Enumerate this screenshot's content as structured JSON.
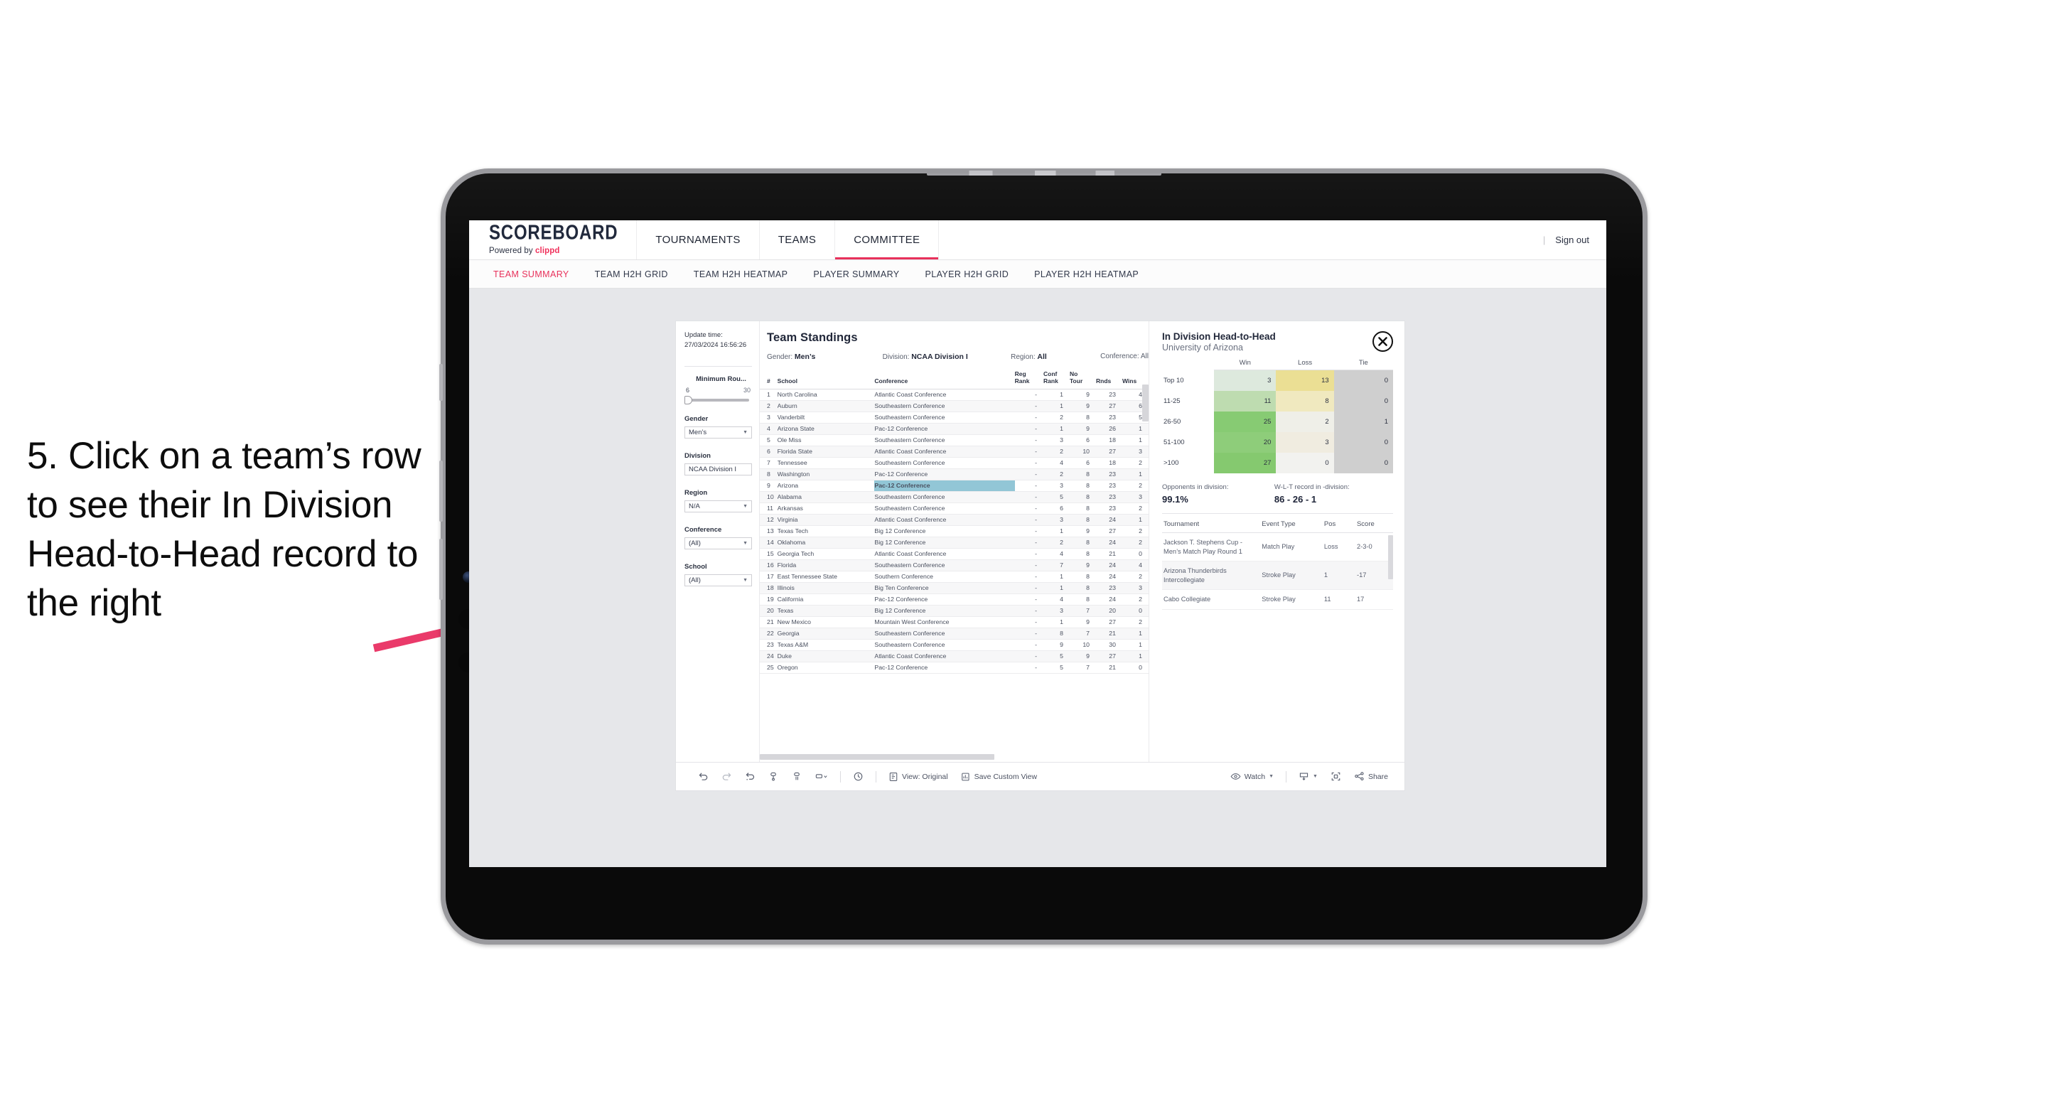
{
  "annotation": {
    "text": "5. Click on a team’s row to see their In Division Head-to-Head record to the right",
    "arrow_color": "#ea3a6a"
  },
  "header": {
    "brand_title": "SCOREBOARD",
    "brand_sub_prefix": "Powered by ",
    "brand_sub_name": "clippd",
    "nav": [
      {
        "label": "TOURNAMENTS",
        "active": false
      },
      {
        "label": "TEAMS",
        "active": false
      },
      {
        "label": "COMMITTEE",
        "active": true
      }
    ],
    "divider": "|",
    "sign_out": "Sign out",
    "accent_color": "#e8315b"
  },
  "subtabs": [
    {
      "label": "TEAM SUMMARY",
      "active": true
    },
    {
      "label": "TEAM H2H GRID",
      "active": false
    },
    {
      "label": "TEAM H2H HEATMAP",
      "active": false
    },
    {
      "label": "PLAYER SUMMARY",
      "active": false
    },
    {
      "label": "PLAYER H2H GRID",
      "active": false
    },
    {
      "label": "PLAYER H2H HEATMAP",
      "active": false
    }
  ],
  "filters": {
    "update_time_label": "Update time:",
    "update_time_value": "27/03/2024 16:56:26",
    "min_rounds": {
      "title": "Minimum Rou...",
      "min": "6",
      "max": "30"
    },
    "gender": {
      "title": "Gender",
      "value": "Men’s"
    },
    "division": {
      "title": "Division",
      "value": "NCAA Division I"
    },
    "region": {
      "title": "Region",
      "value": "N/A"
    },
    "conference": {
      "title": "Conference",
      "value": "(All)"
    },
    "school": {
      "title": "School",
      "value": "(All)"
    }
  },
  "standings": {
    "title": "Team Standings",
    "meta": {
      "gender_label": "Gender:",
      "gender_value": "Men’s",
      "division_label": "Division:",
      "division_value": "NCAA Division I",
      "region_label": "Region:",
      "region_value": "All",
      "conference_label": "Conference:",
      "conference_value": "All"
    },
    "columns": [
      "#",
      "School",
      "Conference",
      "Reg Rank",
      "Conf Rank",
      "No Tour",
      "Rnds",
      "Wins"
    ],
    "columns_split": [
      {
        "l1": "#",
        "l2": ""
      },
      {
        "l1": "School",
        "l2": ""
      },
      {
        "l1": "Conference",
        "l2": ""
      },
      {
        "l1": "Reg",
        "l2": "Rank"
      },
      {
        "l1": "Conf",
        "l2": "Rank"
      },
      {
        "l1": "No",
        "l2": "Tour"
      },
      {
        "l1": "",
        "l2": "Rnds"
      },
      {
        "l1": "",
        "l2": "Wins"
      }
    ],
    "highlighted_row_index": 8,
    "highlight_color": "#92c6d6",
    "rows": [
      {
        "rank": "1",
        "school": "North Carolina",
        "conference": "Atlantic Coast Conference",
        "reg_rank": "-",
        "conf_rank": "1",
        "no_tour": "9",
        "rnds": "23",
        "wins": "4"
      },
      {
        "rank": "2",
        "school": "Auburn",
        "conference": "Southeastern Conference",
        "reg_rank": "-",
        "conf_rank": "1",
        "no_tour": "9",
        "rnds": "27",
        "wins": "6"
      },
      {
        "rank": "3",
        "school": "Vanderbilt",
        "conference": "Southeastern Conference",
        "reg_rank": "-",
        "conf_rank": "2",
        "no_tour": "8",
        "rnds": "23",
        "wins": "5"
      },
      {
        "rank": "4",
        "school": "Arizona State",
        "conference": "Pac-12 Conference",
        "reg_rank": "-",
        "conf_rank": "1",
        "no_tour": "9",
        "rnds": "26",
        "wins": "1"
      },
      {
        "rank": "5",
        "school": "Ole Miss",
        "conference": "Southeastern Conference",
        "reg_rank": "-",
        "conf_rank": "3",
        "no_tour": "6",
        "rnds": "18",
        "wins": "1"
      },
      {
        "rank": "6",
        "school": "Florida State",
        "conference": "Atlantic Coast Conference",
        "reg_rank": "-",
        "conf_rank": "2",
        "no_tour": "10",
        "rnds": "27",
        "wins": "3"
      },
      {
        "rank": "7",
        "school": "Tennessee",
        "conference": "Southeastern Conference",
        "reg_rank": "-",
        "conf_rank": "4",
        "no_tour": "6",
        "rnds": "18",
        "wins": "2"
      },
      {
        "rank": "8",
        "school": "Washington",
        "conference": "Pac-12 Conference",
        "reg_rank": "-",
        "conf_rank": "2",
        "no_tour": "8",
        "rnds": "23",
        "wins": "1"
      },
      {
        "rank": "9",
        "school": "Arizona",
        "conference": "Pac-12 Conference",
        "reg_rank": "-",
        "conf_rank": "3",
        "no_tour": "8",
        "rnds": "23",
        "wins": "2"
      },
      {
        "rank": "10",
        "school": "Alabama",
        "conference": "Southeastern Conference",
        "reg_rank": "-",
        "conf_rank": "5",
        "no_tour": "8",
        "rnds": "23",
        "wins": "3"
      },
      {
        "rank": "11",
        "school": "Arkansas",
        "conference": "Southeastern Conference",
        "reg_rank": "-",
        "conf_rank": "6",
        "no_tour": "8",
        "rnds": "23",
        "wins": "2"
      },
      {
        "rank": "12",
        "school": "Virginia",
        "conference": "Atlantic Coast Conference",
        "reg_rank": "-",
        "conf_rank": "3",
        "no_tour": "8",
        "rnds": "24",
        "wins": "1"
      },
      {
        "rank": "13",
        "school": "Texas Tech",
        "conference": "Big 12 Conference",
        "reg_rank": "-",
        "conf_rank": "1",
        "no_tour": "9",
        "rnds": "27",
        "wins": "2"
      },
      {
        "rank": "14",
        "school": "Oklahoma",
        "conference": "Big 12 Conference",
        "reg_rank": "-",
        "conf_rank": "2",
        "no_tour": "8",
        "rnds": "24",
        "wins": "2"
      },
      {
        "rank": "15",
        "school": "Georgia Tech",
        "conference": "Atlantic Coast Conference",
        "reg_rank": "-",
        "conf_rank": "4",
        "no_tour": "8",
        "rnds": "21",
        "wins": "0"
      },
      {
        "rank": "16",
        "school": "Florida",
        "conference": "Southeastern Conference",
        "reg_rank": "-",
        "conf_rank": "7",
        "no_tour": "9",
        "rnds": "24",
        "wins": "4"
      },
      {
        "rank": "17",
        "school": "East Tennessee State",
        "conference": "Southern Conference",
        "reg_rank": "-",
        "conf_rank": "1",
        "no_tour": "8",
        "rnds": "24",
        "wins": "2"
      },
      {
        "rank": "18",
        "school": "Illinois",
        "conference": "Big Ten Conference",
        "reg_rank": "-",
        "conf_rank": "1",
        "no_tour": "8",
        "rnds": "23",
        "wins": "3"
      },
      {
        "rank": "19",
        "school": "California",
        "conference": "Pac-12 Conference",
        "reg_rank": "-",
        "conf_rank": "4",
        "no_tour": "8",
        "rnds": "24",
        "wins": "2"
      },
      {
        "rank": "20",
        "school": "Texas",
        "conference": "Big 12 Conference",
        "reg_rank": "-",
        "conf_rank": "3",
        "no_tour": "7",
        "rnds": "20",
        "wins": "0"
      },
      {
        "rank": "21",
        "school": "New Mexico",
        "conference": "Mountain West Conference",
        "reg_rank": "-",
        "conf_rank": "1",
        "no_tour": "9",
        "rnds": "27",
        "wins": "2"
      },
      {
        "rank": "22",
        "school": "Georgia",
        "conference": "Southeastern Conference",
        "reg_rank": "-",
        "conf_rank": "8",
        "no_tour": "7",
        "rnds": "21",
        "wins": "1"
      },
      {
        "rank": "23",
        "school": "Texas A&M",
        "conference": "Southeastern Conference",
        "reg_rank": "-",
        "conf_rank": "9",
        "no_tour": "10",
        "rnds": "30",
        "wins": "1"
      },
      {
        "rank": "24",
        "school": "Duke",
        "conference": "Atlantic Coast Conference",
        "reg_rank": "-",
        "conf_rank": "5",
        "no_tour": "9",
        "rnds": "27",
        "wins": "1"
      },
      {
        "rank": "25",
        "school": "Oregon",
        "conference": "Pac-12 Conference",
        "reg_rank": "-",
        "conf_rank": "5",
        "no_tour": "7",
        "rnds": "21",
        "wins": "0"
      }
    ]
  },
  "h2h": {
    "title": "In Division Head-to-Head",
    "subtitle": "University of Arizona",
    "close_icon": "close-circle-icon",
    "chart_data": {
      "type": "heatmap",
      "title": "In Division Head-to-Head",
      "subtitle": "University of Arizona",
      "columns": [
        "Win",
        "Loss",
        "Tie"
      ],
      "rows": [
        "Top 10",
        "11-25",
        "26-50",
        "51-100",
        ">100"
      ],
      "values": [
        [
          3,
          13,
          0
        ],
        [
          11,
          8,
          0
        ],
        [
          25,
          2,
          1
        ],
        [
          20,
          3,
          0
        ],
        [
          27,
          0,
          0
        ]
      ],
      "cell_colors": [
        [
          "#dde9dd",
          "#ebdf94",
          "#cfcfcf"
        ],
        [
          "#bedcb0",
          "#f0e9bf",
          "#cfcfcf"
        ],
        [
          "#87cb73",
          "#efefe8",
          "#cfcfcf"
        ],
        [
          "#8ecd7a",
          "#f0ece0",
          "#cfcfcf"
        ],
        [
          "#85c96f",
          "#f2f2ef",
          "#cfcfcf"
        ]
      ],
      "legend_position": "none",
      "grid": false
    },
    "stats": {
      "opponents_label": "Opponents in division:",
      "opponents_value": "99.1%",
      "record_label": "W-L-T record in -division:",
      "record_value": "86 - 26 - 1"
    },
    "tournaments": {
      "columns": [
        "Tournament",
        "Event Type",
        "Pos",
        "Score"
      ],
      "rows": [
        {
          "tournament": "Jackson T. Stephens Cup - Men’s Match Play Round 1",
          "event_type": "Match Play",
          "pos": "Loss",
          "score": "2-3-0"
        },
        {
          "tournament": "Arizona Thunderbirds Intercollegiate",
          "event_type": "Stroke Play",
          "pos": "1",
          "score": "-17"
        },
        {
          "tournament": "Cabo Collegiate",
          "event_type": "Stroke Play",
          "pos": "11",
          "score": "17"
        }
      ]
    }
  },
  "toolbar": {
    "items": [
      {
        "name": "undo",
        "label": "",
        "icon": "undo-icon"
      },
      {
        "name": "redo",
        "label": "",
        "icon": "redo-icon"
      },
      {
        "name": "revert",
        "label": "",
        "icon": "revert-icon"
      },
      {
        "name": "refresh",
        "label": "",
        "icon": "refresh-data-icon"
      },
      {
        "name": "pause",
        "label": "",
        "icon": "pause-updates-icon"
      },
      {
        "name": "view-dropdown",
        "label": "",
        "icon": "rect-dropdown-icon"
      },
      {
        "name": "history",
        "label": "",
        "icon": "clock-icon"
      }
    ],
    "view_label": "View: Original",
    "save_custom_view_label": "Save Custom View",
    "watch_label": "Watch",
    "share_label": "Share"
  }
}
